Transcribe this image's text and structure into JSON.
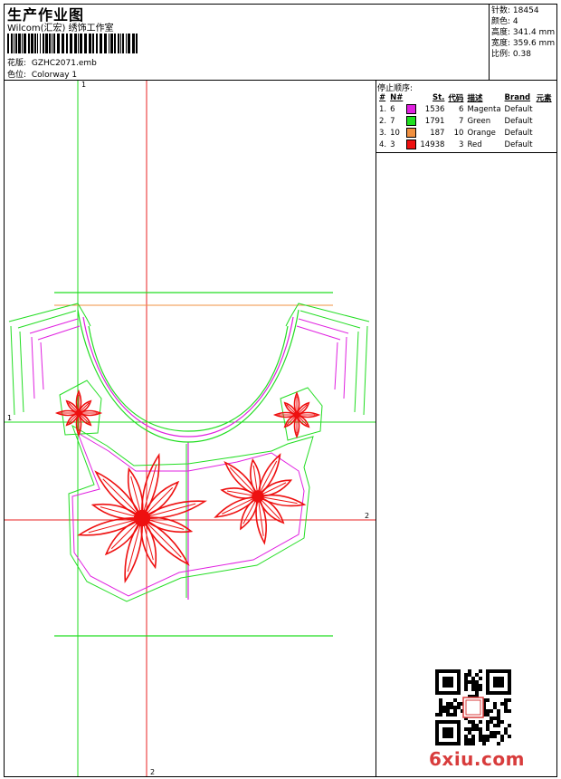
{
  "header": {
    "title": "生产作业图",
    "subtitle": "Wilcom(汇宏) 绣饰工作室",
    "design_label": "花版:",
    "design_value": "GZHC2071.emb",
    "colorway_label": "色位:",
    "colorway_value": "Colorway 1"
  },
  "specs": [
    {
      "label": "针数",
      "value": "18454"
    },
    {
      "label": "颜色",
      "value": "4"
    },
    {
      "label": "高度",
      "value": "341.4 mm"
    },
    {
      "label": "宽度",
      "value": "359.6 mm"
    },
    {
      "label": "比例",
      "value": "0.38"
    }
  ],
  "stop_sequence": {
    "title": "停止顺序:",
    "headers": [
      "#",
      "N#",
      "St.",
      "代码",
      "描述",
      "Brand",
      "元素"
    ],
    "rows": [
      {
        "idx": "1.",
        "n": "6",
        "color": "#e020e0",
        "st": "1536",
        "code": "6",
        "desc": "Magenta",
        "brand": "Default"
      },
      {
        "idx": "2.",
        "n": "7",
        "color": "#20e020",
        "st": "1791",
        "code": "7",
        "desc": "Green",
        "brand": "Default"
      },
      {
        "idx": "3.",
        "n": "10",
        "color": "#f09040",
        "st": "187",
        "code": "10",
        "desc": "Orange",
        "brand": "Default"
      },
      {
        "idx": "4.",
        "n": "3",
        "color": "#ee1010",
        "st": "14938",
        "code": "3",
        "desc": "Red",
        "brand": "Default"
      }
    ]
  },
  "design": {
    "guide_labels": {
      "v1": "1",
      "h1": "1",
      "v2": "2",
      "h2": "2"
    }
  },
  "watermark": "6xiu.com"
}
